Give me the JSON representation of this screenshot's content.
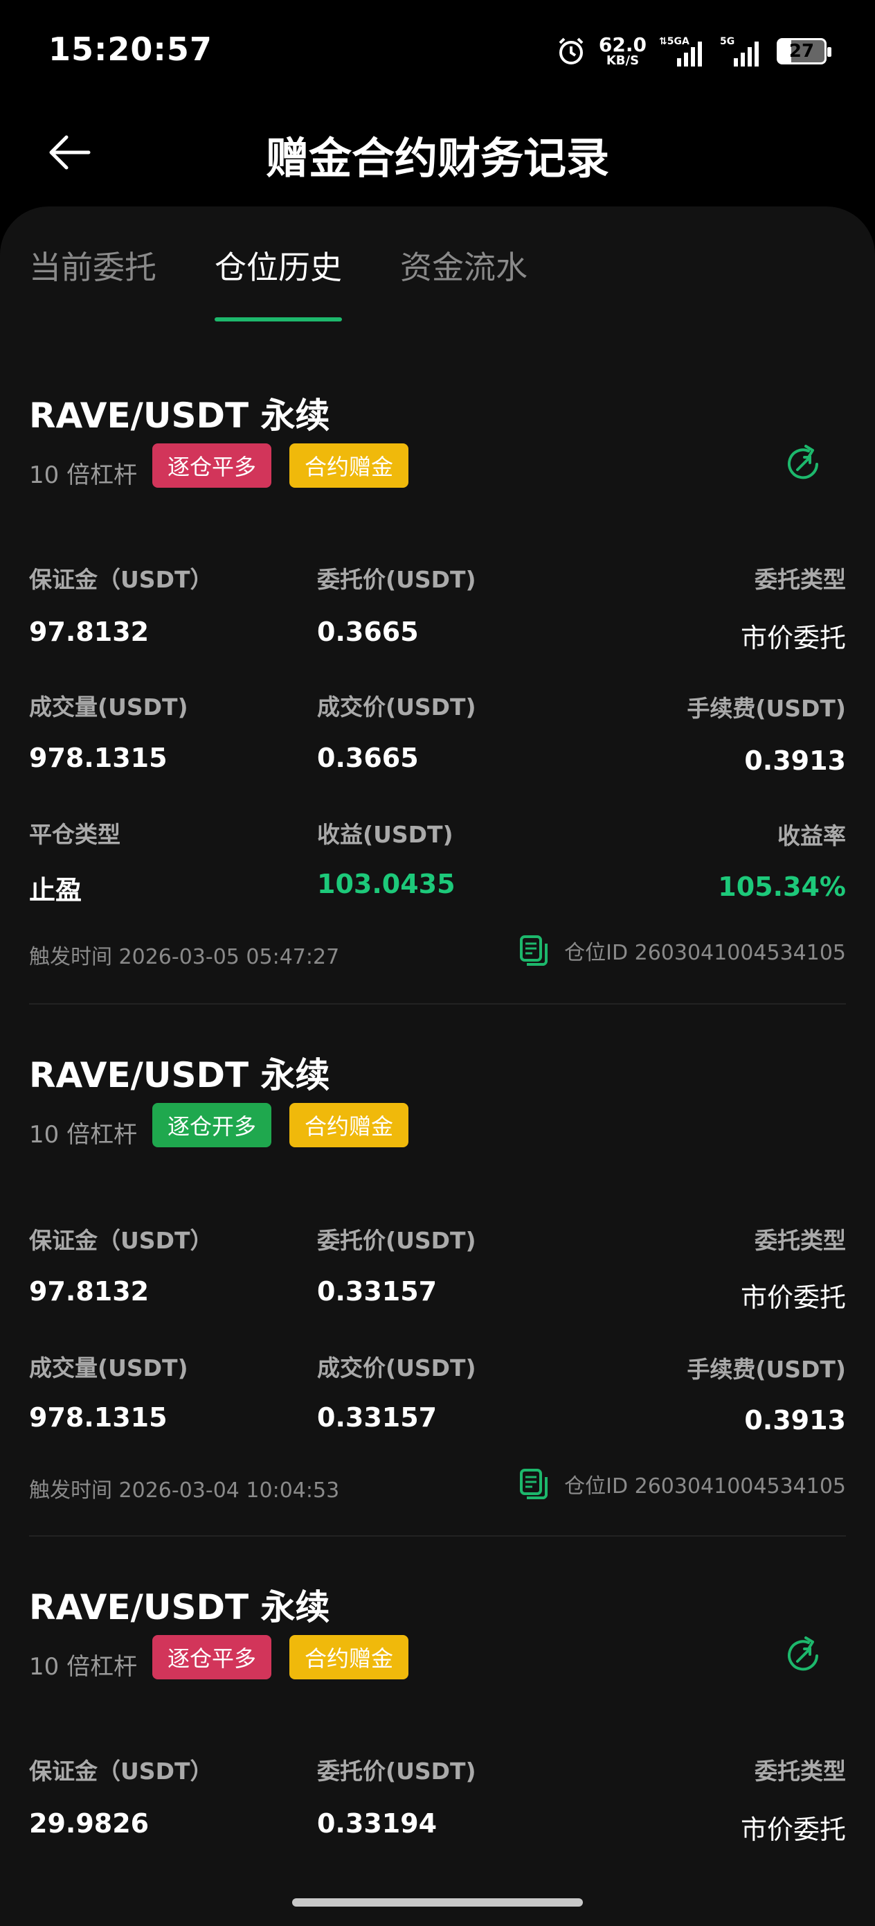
{
  "status": {
    "time": "15:20:57",
    "net_speed": "62.0",
    "net_unit": "KB/S",
    "battery": "27",
    "signal1": "5GA",
    "signal2": "5G"
  },
  "header": {
    "title": "赠金合约财务记录"
  },
  "tabs": [
    "当前委托",
    "仓位历史",
    "资金流水"
  ],
  "active_tab": 1,
  "labels": {
    "margin": "保证金（USDT）",
    "order_price": "委托价(USDT)",
    "order_type": "委托类型",
    "volume": "成交量(USDT)",
    "fill_price": "成交价(USDT)",
    "fee": "手续费(USDT)",
    "close_type": "平仓类型",
    "pnl": "收益(USDT)",
    "roi": "收益率",
    "trigger_time_label": "触发时间",
    "position_id_label": "仓位ID"
  },
  "records": [
    {
      "symbol": "RAVE/USDT 永续",
      "leverage": "10 倍杠杆",
      "side_tag": "逐仓平多",
      "bonus_tag": "合约赠金",
      "margin": "97.8132",
      "order_price": "0.3665",
      "order_type": "市价委托",
      "volume": "978.1315",
      "fill_price": "0.3665",
      "fee": "0.3913",
      "close_type": "止盈",
      "pnl": "103.0435",
      "roi": "105.34%",
      "trigger_time": "2026-03-05 05:47:27",
      "position_id": "2603041004534105"
    },
    {
      "symbol": "RAVE/USDT 永续",
      "leverage": "10 倍杠杆",
      "side_tag": "逐仓开多",
      "bonus_tag": "合约赠金",
      "margin": "97.8132",
      "order_price": "0.33157",
      "order_type": "市价委托",
      "volume": "978.1315",
      "fill_price": "0.33157",
      "fee": "0.3913",
      "trigger_time": "2026-03-04 10:04:53",
      "position_id": "2603041004534105"
    },
    {
      "symbol": "RAVE/USDT 永续",
      "leverage": "10 倍杠杆",
      "side_tag": "逐仓平多",
      "bonus_tag": "合约赠金",
      "margin": "29.9826",
      "order_price": "0.33194",
      "order_type": "市价委托"
    }
  ],
  "colors": {
    "accent": "#1db86c",
    "profit": "#1dc97a",
    "close_tag": "#d2355a",
    "open_tag": "#1fa84e",
    "bonus_tag": "#f0b90b"
  }
}
